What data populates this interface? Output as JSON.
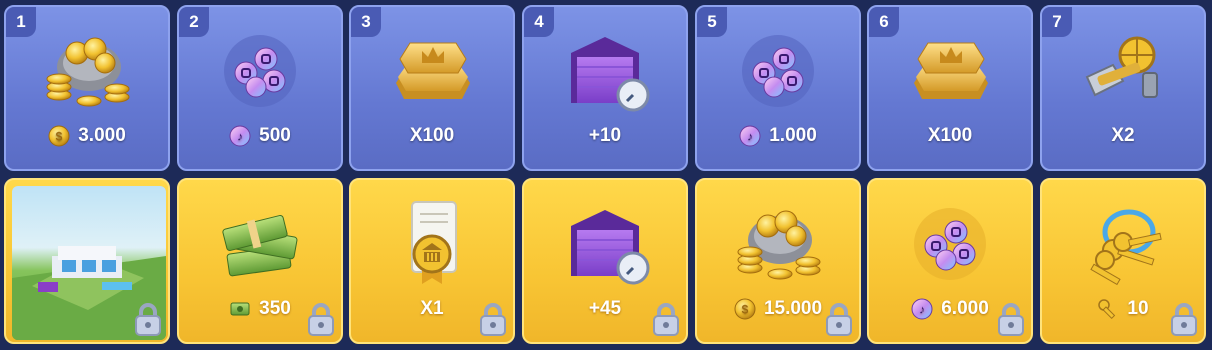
{
  "rewards_row1": [
    {
      "day": "1",
      "amount": "3.000",
      "item_icon": "coin-bag-icon",
      "mini_icon": "coin-icon"
    },
    {
      "day": "2",
      "amount": "500",
      "item_icon": "music-tokens-icon",
      "mini_icon": "music-token-icon"
    },
    {
      "day": "3",
      "amount": "X100",
      "item_icon": "crown-gold-bars-icon",
      "mini_icon": ""
    },
    {
      "day": "4",
      "amount": "+10",
      "item_icon": "garage-speedup-icon",
      "mini_icon": ""
    },
    {
      "day": "5",
      "amount": "1.000",
      "item_icon": "music-tokens-icon",
      "mini_icon": "music-token-icon"
    },
    {
      "day": "6",
      "amount": "X100",
      "item_icon": "crown-gold-bars-icon",
      "mini_icon": ""
    },
    {
      "day": "7",
      "amount": "X2",
      "item_icon": "building-tools-icon",
      "mini_icon": ""
    }
  ],
  "rewards_row2": [
    {
      "amount": "",
      "item_icon": "mansion-building-image",
      "mini_icon": "",
      "locked": true
    },
    {
      "amount": "350",
      "item_icon": "cash-stack-icon",
      "mini_icon": "cash-icon",
      "locked": true
    },
    {
      "amount": "X1",
      "item_icon": "city-hall-certificate-icon",
      "mini_icon": "",
      "locked": true
    },
    {
      "amount": "+45",
      "item_icon": "garage-speedup-icon",
      "mini_icon": "",
      "locked": true
    },
    {
      "amount": "15.000",
      "item_icon": "coin-bag-icon",
      "mini_icon": "coin-icon",
      "locked": true
    },
    {
      "amount": "6.000",
      "item_icon": "music-tokens-icon",
      "mini_icon": "music-token-icon",
      "locked": true
    },
    {
      "amount": "10",
      "item_icon": "golden-keys-icon",
      "mini_icon": "key-icon",
      "locked": true
    }
  ],
  "colors": {
    "free_card": "#6a7fd8",
    "premium_card": "#f8c534",
    "background": "#1d2a58"
  }
}
